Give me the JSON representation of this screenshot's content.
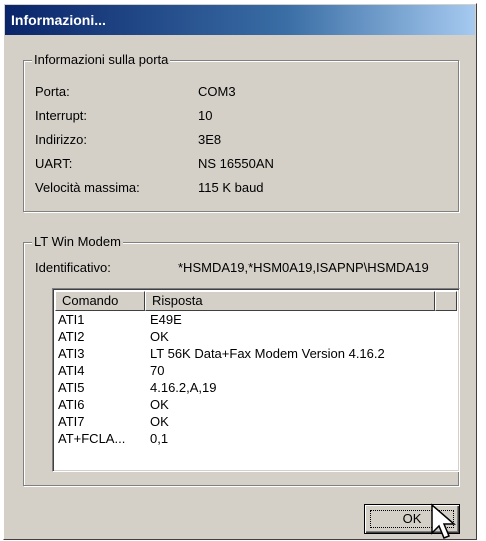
{
  "window": {
    "title": "Informazioni..."
  },
  "port_group": {
    "legend": "Informazioni sulla porta",
    "rows": [
      {
        "label": "Porta:",
        "value": "COM3"
      },
      {
        "label": "Interrupt:",
        "value": "10"
      },
      {
        "label": "Indirizzo:",
        "value": "3E8"
      },
      {
        "label": "UART:",
        "value": "NS 16550AN"
      },
      {
        "label": "Velocità massima:",
        "value": "115 K baud"
      }
    ]
  },
  "modem_group": {
    "legend": "LT Win Modem",
    "identifier_label": "Identificativo:",
    "identifier_value": "*HSMDA19,*HSM0A19,ISAPNP\\HSMDA19",
    "list": {
      "headers": [
        "Comando",
        "Risposta"
      ],
      "rows": [
        {
          "cmd": "ATI1",
          "resp": "E49E"
        },
        {
          "cmd": "ATI2",
          "resp": "OK"
        },
        {
          "cmd": "ATI3",
          "resp": "LT 56K Data+Fax Modem Version 4.16.2"
        },
        {
          "cmd": "ATI4",
          "resp": "70"
        },
        {
          "cmd": "ATI5",
          "resp": "4.16.2,A,19"
        },
        {
          "cmd": "ATI6",
          "resp": "OK"
        },
        {
          "cmd": "ATI7",
          "resp": "OK"
        },
        {
          "cmd": "AT+FCLA...",
          "resp": "0,1"
        }
      ]
    }
  },
  "buttons": {
    "ok_label": "OK"
  },
  "icons": {
    "cursor": "arrow-cursor-icon"
  }
}
